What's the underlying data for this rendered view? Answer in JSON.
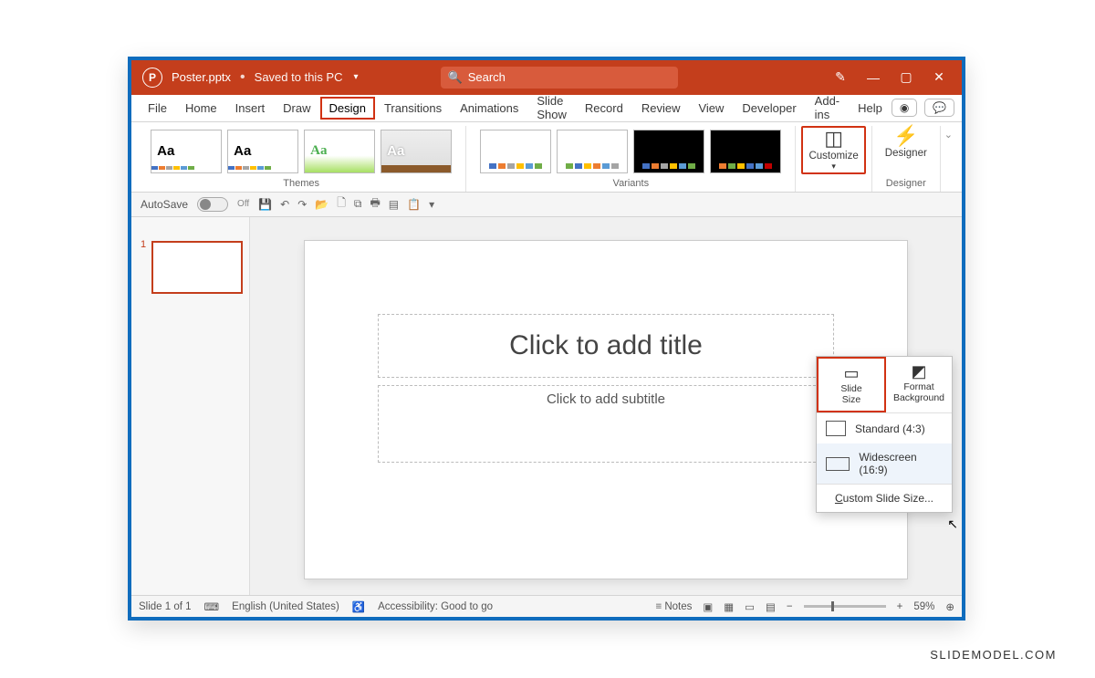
{
  "titlebar": {
    "filename": "Poster.pptx",
    "saved_status": "Saved to this PC",
    "search_placeholder": "Search"
  },
  "menubar": {
    "tabs": [
      "File",
      "Home",
      "Insert",
      "Draw",
      "Design",
      "Transitions",
      "Animations",
      "Slide Show",
      "Record",
      "Review",
      "View",
      "Developer",
      "Add-ins",
      "Help"
    ],
    "active": "Design"
  },
  "ribbon": {
    "themes_label": "Themes",
    "variants_label": "Variants",
    "customize_label": "Customize",
    "designer_label": "Designer",
    "designer_group_label": "Designer"
  },
  "quickaccess": {
    "autosave_label": "AutoSave",
    "autosave_state": "Off"
  },
  "slide": {
    "title_placeholder": "Click to add title",
    "subtitle_placeholder": "Click to add subtitle",
    "thumb_number": "1"
  },
  "dropdown": {
    "slide_size_label": "Slide\nSize",
    "format_bg_label": "Format\nBackground",
    "standard_label": "Standard (4:3)",
    "widescreen_label": "Widescreen (16:9)",
    "custom_label": "Custom Slide Size..."
  },
  "statusbar": {
    "slide_count": "Slide 1 of 1",
    "language": "English (United States)",
    "accessibility": "Accessibility: Good to go",
    "notes_label": "Notes",
    "zoom_value": "59%"
  },
  "attribution": "SLIDEMODEL.COM"
}
